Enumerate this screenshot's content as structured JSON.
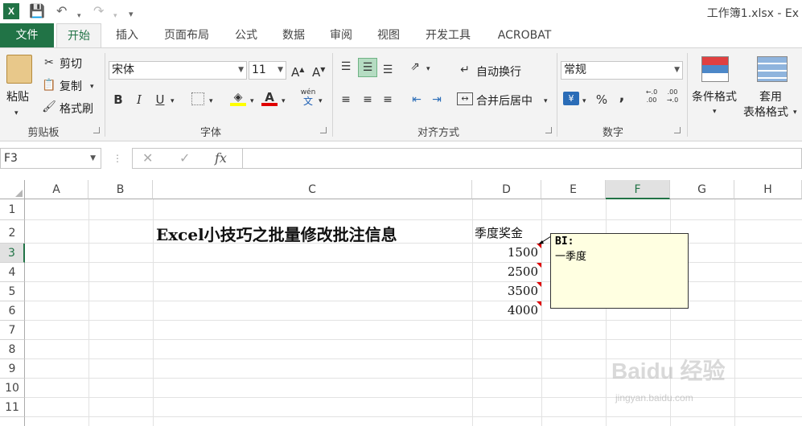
{
  "app": {
    "title": "工作簿1.xlsx - Ex",
    "logo": "X",
    "quick_access": [
      "save-icon",
      "undo-icon",
      "redo-icon",
      "customize-icon"
    ]
  },
  "tabs": [
    "文件",
    "开始",
    "插入",
    "页面布局",
    "公式",
    "数据",
    "审阅",
    "视图",
    "开发工具",
    "ACROBAT"
  ],
  "active_tab": "开始",
  "ribbon": {
    "clipboard": {
      "paste": "粘贴",
      "cut": "剪切",
      "copy": "复制",
      "format_painter": "格式刷",
      "label": "剪贴板"
    },
    "font": {
      "name": "宋体",
      "size": "11",
      "bold": "B",
      "italic": "I",
      "underline": "U",
      "grow": "A",
      "shrink": "A",
      "font_color": "A",
      "phonetic": "wén",
      "phonetic_sub": "文",
      "label": "字体"
    },
    "alignment": {
      "wrap_text": "自动换行",
      "merge_center": "合并后居中",
      "label": "对齐方式"
    },
    "number": {
      "format": "常规",
      "percent": "%",
      "comma": ",",
      "inc_decimal": "←.0\n.00",
      "dec_decimal": ".00\n→.0",
      "label": "数字"
    },
    "styles": {
      "conditional": "条件格式",
      "table_line1": "套用",
      "table_line2": "表格格式"
    }
  },
  "formula_bar": {
    "name_box": "F3",
    "cancel": "✕",
    "enter": "✓",
    "fx": "fx",
    "value": ""
  },
  "columns": [
    "A",
    "B",
    "C",
    "D",
    "E",
    "F",
    "G",
    "H"
  ],
  "rows": [
    "1",
    "2",
    "3",
    "4",
    "5",
    "6",
    "7",
    "8",
    "9",
    "10",
    "11"
  ],
  "selected_cell": {
    "column": "F",
    "row": "3"
  },
  "cells": {
    "C2": "Excel小技巧之批量修改批注信息",
    "D2": "季度奖金",
    "D3": "1500",
    "D4": "2500",
    "D5": "3500",
    "D6": "4000"
  },
  "comment": {
    "author": "BI:",
    "text": "一季度"
  },
  "watermark": {
    "brand": "Baidu 经验",
    "url": "jingyan.baidu.com"
  }
}
